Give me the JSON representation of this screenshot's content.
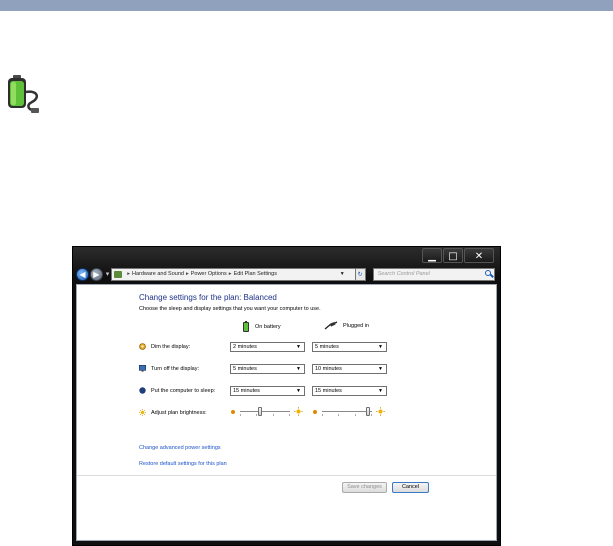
{
  "window": {
    "controls": {
      "minimize": "▁",
      "maximize": "□",
      "close": "✕"
    }
  },
  "navbar": {
    "breadcrumb": [
      "Hardware and Sound",
      "Power Options",
      "Edit Plan Settings"
    ],
    "search_placeholder": "Search Control Panel"
  },
  "content": {
    "heading": "Change settings for the plan: Balanced",
    "subheading": "Choose the sleep and display settings that you want your computer to use.",
    "columns": {
      "battery": "On battery",
      "plugged": "Plugged in"
    },
    "rows": [
      {
        "label": "Dim the display:",
        "battery": "2 minutes",
        "plugged": "5 minutes"
      },
      {
        "label": "Turn off the display:",
        "battery": "5 minutes",
        "plugged": "10 minutes"
      },
      {
        "label": "Put the computer to sleep:",
        "battery": "15 minutes",
        "plugged": "15 minutes"
      }
    ],
    "brightness": {
      "label": "Adjust plan brightness:",
      "battery_level": 0.4,
      "plugged_level": 0.95
    },
    "links": {
      "advanced": "Change advanced power settings",
      "restore": "Restore default settings for this plan"
    },
    "buttons": {
      "save": "Save changes",
      "cancel": "Cancel"
    }
  },
  "colors": {
    "heading": "#1e3287",
    "link": "#1c54c8",
    "topbar": "#8fa1bd"
  }
}
